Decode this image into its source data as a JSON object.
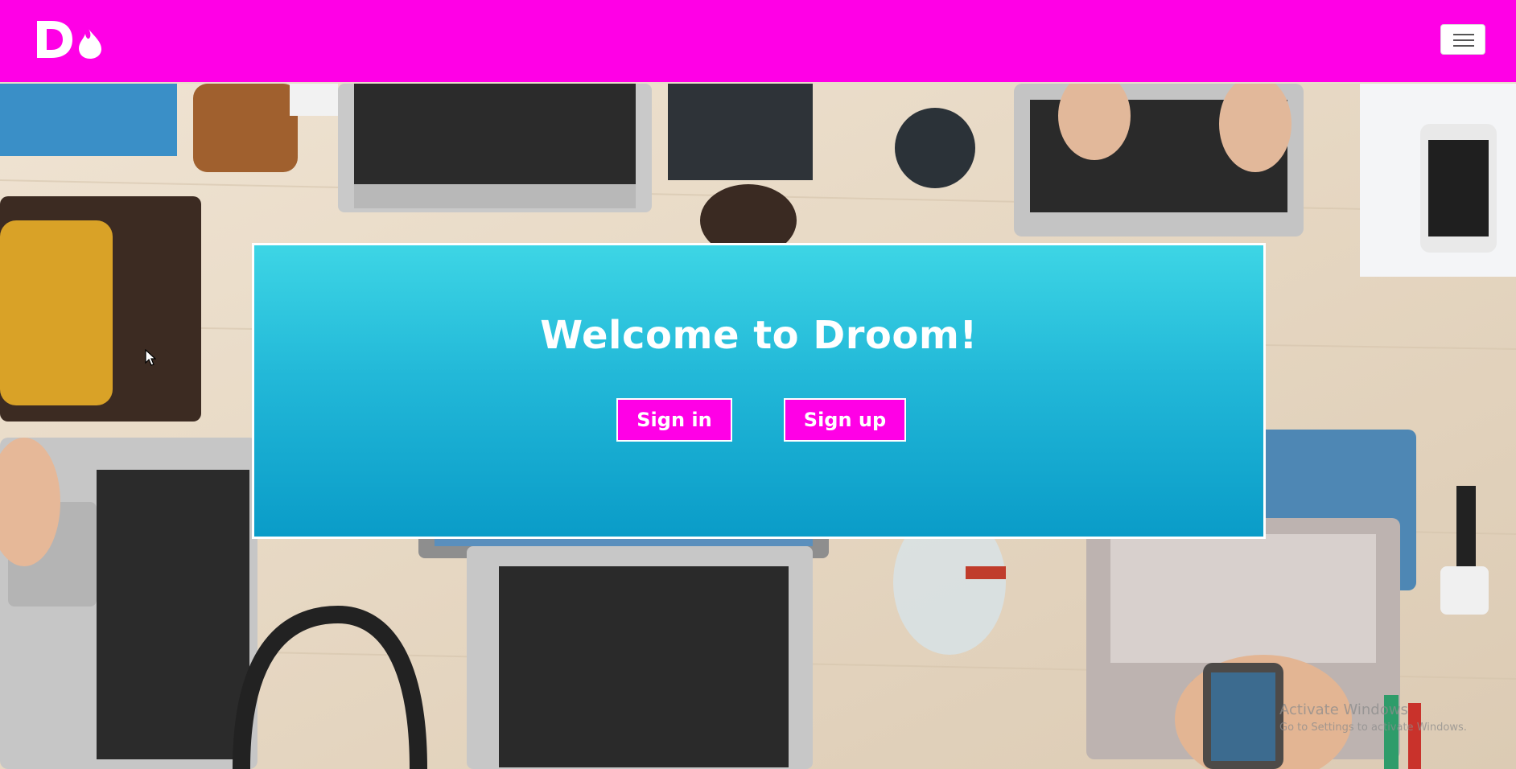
{
  "navbar": {
    "logo_text": "Do",
    "menu_icon": "hamburger-menu-icon",
    "brand_color": "#ff00e6"
  },
  "hero": {
    "title": "Welcome to Droom!",
    "signin_label": "Sign in",
    "signup_label": "Sign up",
    "gradient_top": "#3dd5e5",
    "gradient_bottom": "#0a9cc8"
  },
  "watermark": {
    "title": "Activate Windows",
    "subtitle": "Go to Settings to activate Windows."
  }
}
